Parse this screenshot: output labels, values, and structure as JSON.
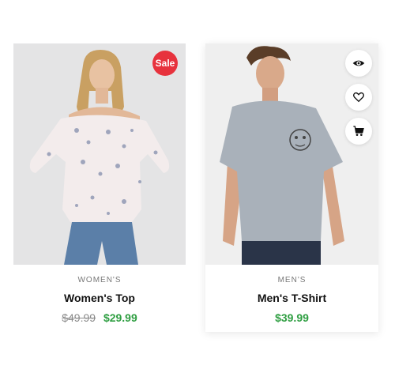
{
  "products": [
    {
      "category": "WOMEN'S",
      "title": "Women's Top",
      "old_price": "$49.99",
      "price": "$29.99",
      "badge": "Sale"
    },
    {
      "category": "MEN'S",
      "title": "Men's T-Shirt",
      "price": "$39.99",
      "actions": [
        "eye-icon",
        "heart-icon",
        "cart-icon"
      ]
    }
  ],
  "colors": {
    "sale_badge": "#e7323d",
    "price": "#2e9e41",
    "old_price": "#8a8a8a"
  }
}
